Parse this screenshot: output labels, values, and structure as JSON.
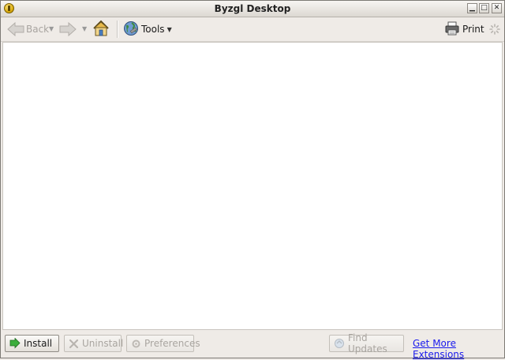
{
  "window": {
    "title": "Byzgl Desktop",
    "min_label": "▁",
    "max_label": "□",
    "close_label": "✕"
  },
  "toolbar": {
    "back_label": "Back",
    "tools_label": "Tools",
    "print_label": "Print",
    "icons": {
      "back": "back-arrow-icon",
      "forward": "forward-arrow-icon",
      "home": "home-icon",
      "tools": "globe-icon",
      "print": "printer-icon",
      "throbber": "throbber-icon"
    }
  },
  "bottombar": {
    "install_label": "Install",
    "uninstall_label": "Uninstall",
    "preferences_label": "Preferences",
    "find_updates_label": "Find Updates",
    "more_extensions_label": "Get More Extensions"
  },
  "colors": {
    "link": "#1a1aee",
    "disabled_text": "#a9a5a0",
    "install_accent": "#2f9a2f"
  }
}
